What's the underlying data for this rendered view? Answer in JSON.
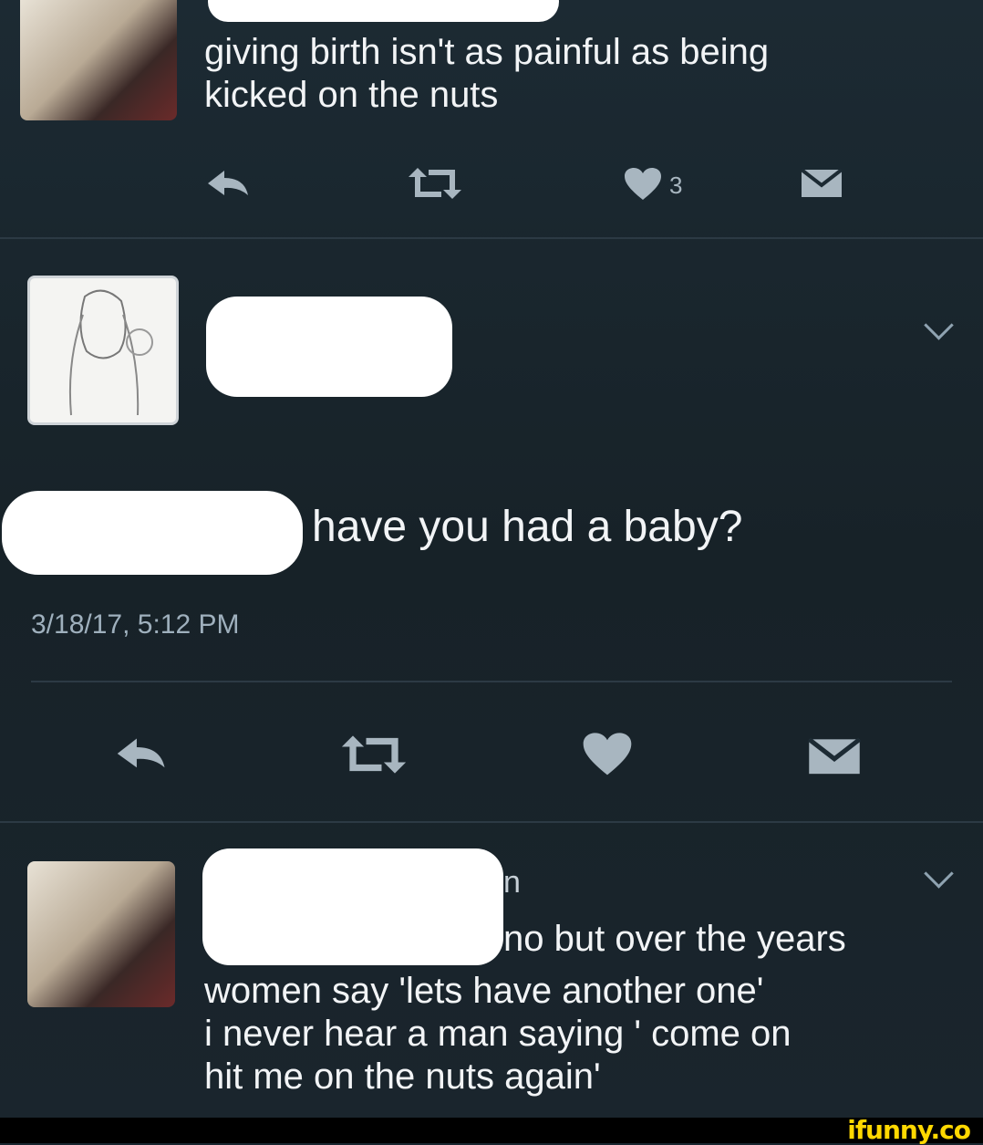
{
  "tweet1": {
    "text": "giving birth isn't as painful as being\nkicked on the nuts",
    "like_count": "3"
  },
  "tweet2": {
    "reply_text": "have you had a baby?",
    "timestamp": "3/18/17, 5:12 PM"
  },
  "tweet3": {
    "name_fragment": "n",
    "text_line1": "no but over the years",
    "text_rest": "women say 'lets have another one'\ni never hear a man saying ' come on\nhit me on the nuts again'"
  },
  "icons": {
    "reply": "reply-icon",
    "retweet": "retweet-icon",
    "like": "heart-icon",
    "message": "envelope-icon"
  },
  "footer": {
    "watermark": "ifunny.co"
  },
  "colors": {
    "background": "#1c2a33",
    "text": "#f2f4f6",
    "icon": "#a8b6c0",
    "watermark": "#ffd800"
  }
}
